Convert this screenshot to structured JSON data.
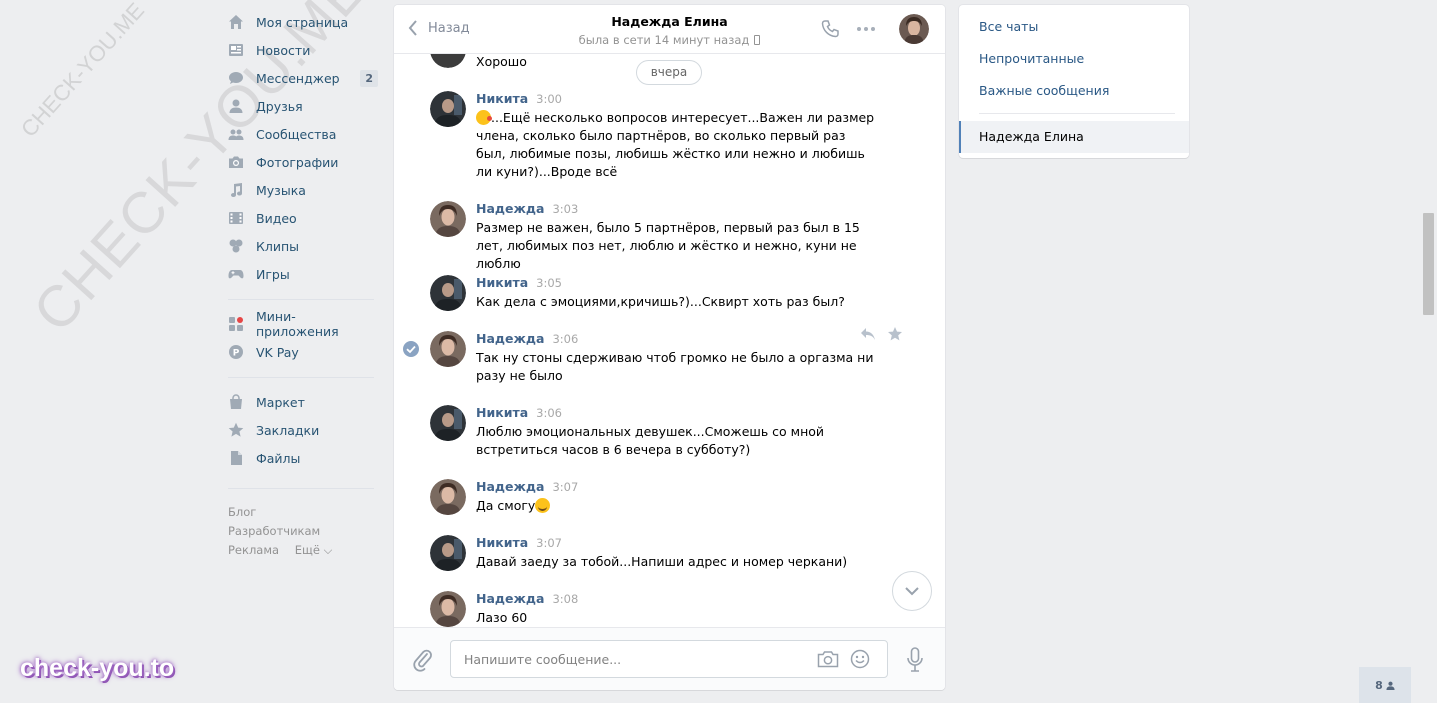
{
  "watermark": {
    "big": "CHECK-YOU.ME",
    "small": "CHECK-YOU.ME",
    "badge": "check-you.to"
  },
  "nav": {
    "items": [
      {
        "label": "Моя страница",
        "icon": "home-icon"
      },
      {
        "label": "Новости",
        "icon": "news-icon"
      },
      {
        "label": "Мессенджер",
        "icon": "messenger-icon",
        "badge": "2"
      },
      {
        "label": "Друзья",
        "icon": "friends-icon"
      },
      {
        "label": "Сообщества",
        "icon": "groups-icon"
      },
      {
        "label": "Фотографии",
        "icon": "camera-icon"
      },
      {
        "label": "Музыка",
        "icon": "music-icon"
      },
      {
        "label": "Видео",
        "icon": "video-icon"
      },
      {
        "label": "Клипы",
        "icon": "clips-icon"
      },
      {
        "label": "Игры",
        "icon": "gamepad-icon"
      }
    ],
    "items2": [
      {
        "label": "Мини-приложения",
        "icon": "apps-icon"
      },
      {
        "label": "VK Pay",
        "icon": "vkpay-icon"
      }
    ],
    "items3": [
      {
        "label": "Маркет",
        "icon": "market-icon"
      },
      {
        "label": "Закладки",
        "icon": "star-icon"
      },
      {
        "label": "Файлы",
        "icon": "file-icon"
      }
    ],
    "footer": {
      "blog": "Блог",
      "dev": "Разработчикам",
      "ads": "Реклама",
      "more": "Ещё ⌵"
    }
  },
  "chat": {
    "back": "Назад",
    "name": "Надежда Елина",
    "status": "была в сети 14 минут назад",
    "prev_fragment": "Хорошо",
    "day": "вчера",
    "messages": [
      {
        "author": "Никита",
        "time": "3:00",
        "emoji_prefix": "kiss",
        "text": "...Ещё несколько вопросов интересует...Важен ли размер члена, сколько было партнёров, во сколько первый раз был, любимые позы, любишь жёстко или нежно и любишь ли куни?)...Вроде всё"
      },
      {
        "author": "Надежда",
        "time": "3:03",
        "text": "Размер не важен, было 5 партнёров, первый раз был в 15 лет, любимых поз нет, люблю и жёстко и нежно, куни не люблю"
      },
      {
        "author": "Никита",
        "time": "3:05",
        "text": "Как дела с эмоциями,кричишь?)...Сквирт хоть раз был?"
      },
      {
        "author": "Надежда",
        "time": "3:06",
        "text": "Так ну стоны сдерживаю чтоб громко не было а оргазма ни разу не было"
      },
      {
        "author": "Никита",
        "time": "3:06",
        "text": "Люблю эмоциональных девушек...Сможешь со мной встретиться часов в 6 вечера в субботу?)"
      },
      {
        "author": "Надежда",
        "time": "3:07",
        "text": "Да смогу",
        "emoji_suffix": "smile"
      },
      {
        "author": "Никита",
        "time": "3:07",
        "text": "Давай заеду за тобой...Напиши адрес и номер черкани)"
      },
      {
        "author": "Надежда",
        "time": "3:08",
        "text": "Лазо 60"
      }
    ],
    "input_placeholder": "Напишите сообщение..."
  },
  "right": {
    "all": "Все чаты",
    "unread": "Непрочитанные",
    "important": "Важные сообщения",
    "active": "Надежда Елина"
  },
  "online_count": "8",
  "colors": {
    "link": "#2a5885",
    "author": "#42648b",
    "bg": "#edeef0",
    "accent": "#5181b8"
  }
}
